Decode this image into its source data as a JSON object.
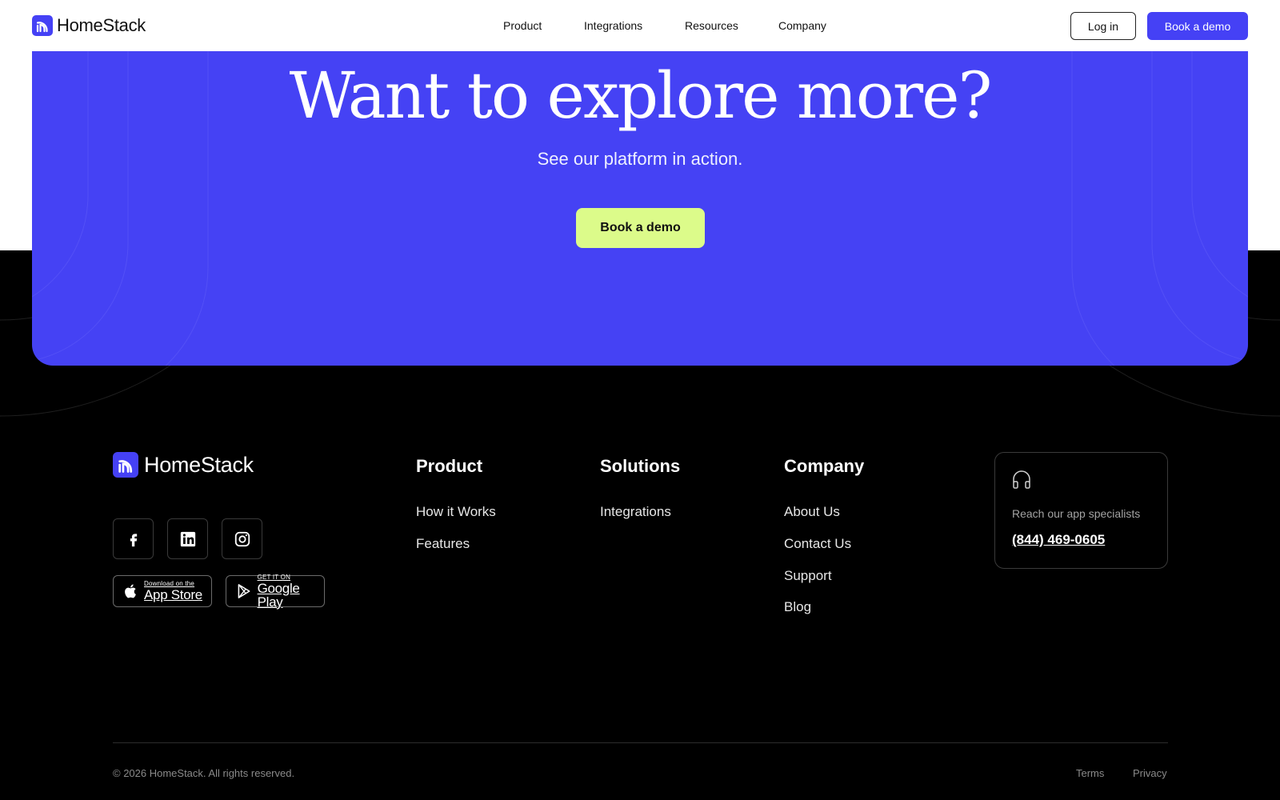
{
  "brand": {
    "name": "HomeStack",
    "logo_icon": "homestack-logo-icon",
    "accent": "#4541f5"
  },
  "nav": {
    "links": [
      "Product",
      "Integrations",
      "Resources",
      "Company"
    ],
    "login_label": "Log in",
    "demo_label": "Book a demo"
  },
  "cta": {
    "title": "Want to explore more?",
    "subtitle": "See our platform in action.",
    "button_label": "Book a demo",
    "background": "#4542f4",
    "button_color": "#dcfb8a"
  },
  "footer": {
    "brand_name": "HomeStack",
    "social_icons": [
      "facebook-icon",
      "linkedin-icon",
      "instagram-icon"
    ],
    "app_store": {
      "small": "Download on the",
      "big": "App Store"
    },
    "google_play": {
      "small": "GET IT ON",
      "big": "Google Play"
    },
    "columns": [
      {
        "heading": "Product",
        "links": [
          "How it Works",
          "Features"
        ]
      },
      {
        "heading": "Solutions",
        "links": [
          "Integrations"
        ]
      },
      {
        "heading": "Company",
        "links": [
          "About Us",
          "Contact Us",
          "Support",
          "Blog"
        ]
      }
    ],
    "contact": {
      "icon": "headphones-icon",
      "label": "Reach our app specialists",
      "phone": "(844) 469-0605"
    },
    "copyright": "© 2026 HomeStack. All rights reserved.",
    "legal": [
      "Terms",
      "Privacy"
    ]
  }
}
